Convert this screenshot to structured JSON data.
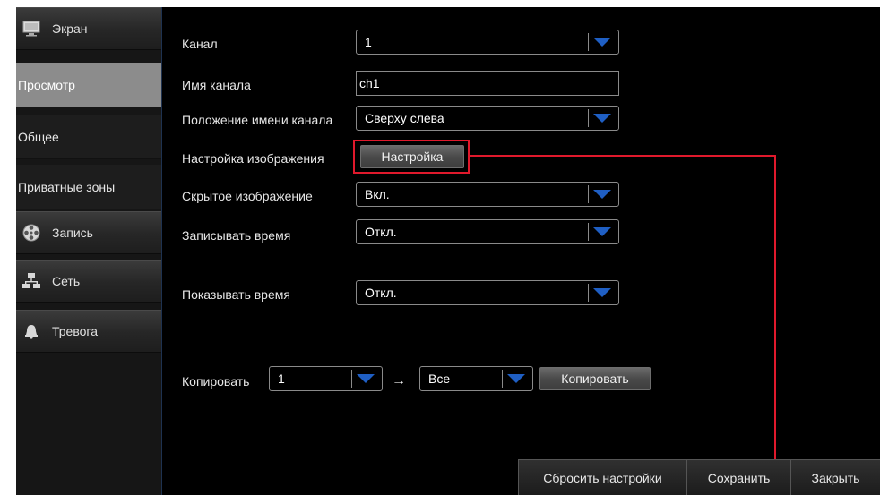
{
  "sidebar": {
    "screen": "Экран",
    "sub_items": [
      "Просмотр",
      "Общее",
      "Приватные зоны"
    ],
    "record": "Запись",
    "network": "Сеть",
    "alarm": "Тревога"
  },
  "form": {
    "channel": {
      "label": "Канал",
      "value": "1"
    },
    "channel_name": {
      "label": "Имя канала",
      "value": "ch1"
    },
    "name_position": {
      "label": "Положение имени канала",
      "value": "Сверху слева"
    },
    "image_settings": {
      "label": "Настройка изображения",
      "button": "Настройка"
    },
    "hidden_image": {
      "label": "Скрытое изображение",
      "value": "Вкл."
    },
    "record_time": {
      "label": "Записывать время",
      "value": "Откл."
    },
    "show_time": {
      "label": "Показывать время",
      "value": "Откл."
    }
  },
  "copy": {
    "label": "Копировать",
    "from": "1",
    "arrow": "→",
    "to": "Все",
    "button": "Копировать"
  },
  "footer": {
    "reset": "Сбросить настройки",
    "save": "Сохранить",
    "close": "Закрыть"
  },
  "colors": {
    "highlight": "#e0192c",
    "dropdown_arrow": "#1f5fc4",
    "active_item": "#8c8c8c"
  },
  "icons": {
    "screen": "monitor-icon",
    "record": "film-reel-icon",
    "network": "network-icon",
    "alarm": "bell-icon",
    "dropdown": "triangle-down-icon"
  }
}
